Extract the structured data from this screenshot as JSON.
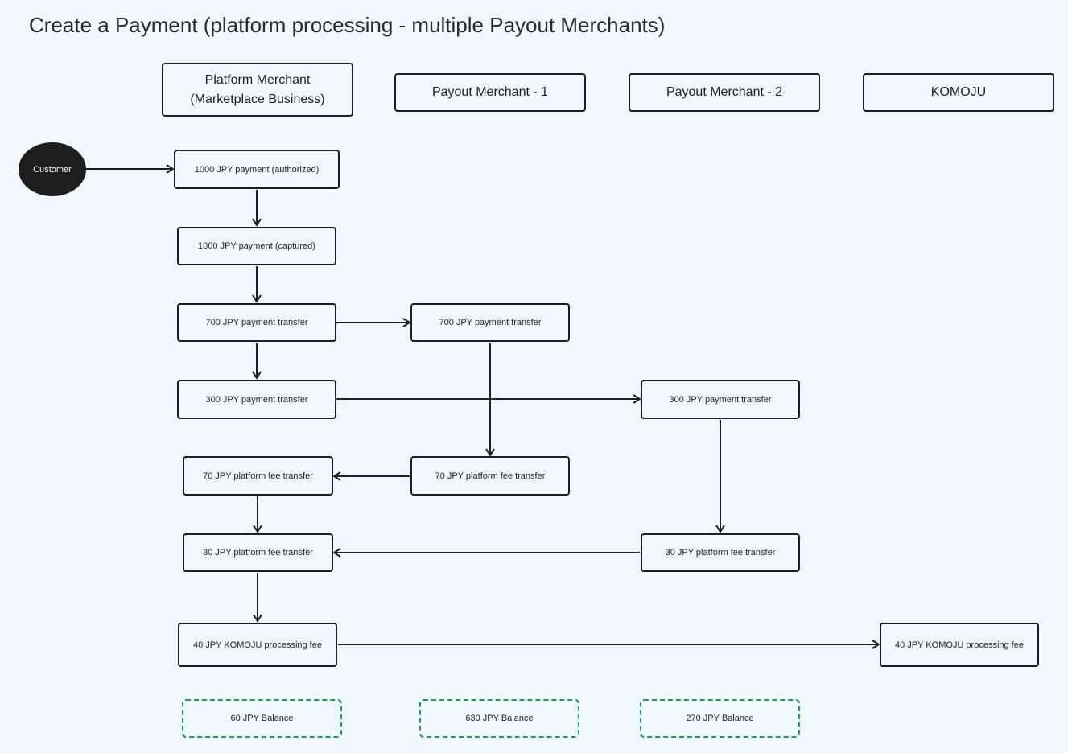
{
  "title": "Create a Payment (platform processing - multiple Payout Merchants)",
  "lanes": {
    "platform": [
      "Platform Merchant",
      "(Marketplace Business)"
    ],
    "payout1": "Payout Merchant - 1",
    "payout2": "Payout Merchant - 2",
    "komoju": "KOMOJU"
  },
  "customer": "Customer",
  "nodes": {
    "authorized": "1000 JPY payment (authorized)",
    "captured": "1000 JPY payment (captured)",
    "transfer700_pm": "700 JPY payment transfer",
    "transfer700_p1": "700 JPY payment transfer",
    "transfer300_pm": "300 JPY payment transfer",
    "transfer300_p2": "300 JPY payment transfer",
    "fee70_pm": "70 JPY platform fee transfer",
    "fee70_p1": "70 JPY platform fee transfer",
    "fee30_pm": "30 JPY platform fee transfer",
    "fee30_p2": "30 JPY platform fee transfer",
    "komoju_fee_pm": "40 JPY KOMOJU processing fee",
    "komoju_fee_k": "40 JPY KOMOJU processing fee"
  },
  "balances": {
    "platform": "60 JPY Balance",
    "payout1": "630 JPY Balance",
    "payout2": "270 JPY Balance"
  },
  "colors": {
    "stroke": "#1e1e1e",
    "balance": "#12a150",
    "background": "#f0f7fe"
  }
}
